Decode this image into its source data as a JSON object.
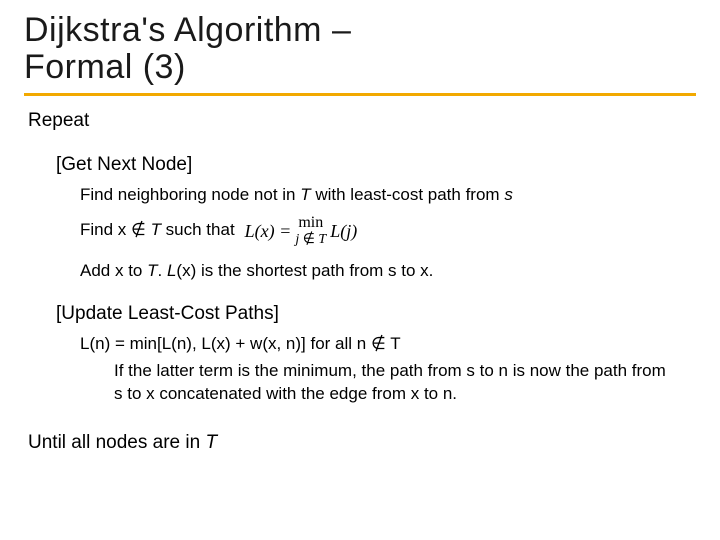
{
  "title_line1": "Dijkstra's Algorithm –",
  "title_line2": "Formal (3)",
  "repeat": "Repeat",
  "get_next_node": "[Get Next Node]",
  "find_neighbor_a": "Find neighboring node not in ",
  "find_neighbor_T": "T",
  "find_neighbor_b": " with least-cost path from ",
  "find_neighbor_s": "s",
  "find_x_a": "Find x ",
  "notin": "∉",
  "find_x_T": " T",
  "find_x_b": " such that",
  "formula_Lx": "L(x) =",
  "formula_min": "min",
  "formula_cond_a": "j ",
  "formula_cond_b": " T",
  "formula_Lj": "L(j)",
  "add_x_a": "Add x to ",
  "add_x_T": "T",
  "add_x_b": ".  ",
  "add_x_Lx": "L",
  "add_x_c": "(x) is the shortest path from s to x.",
  "update_header": "[Update Least-Cost Paths]",
  "ln_eq": "L(n) = min[L(n), L(x) + w(x, n)]   for all n ",
  "ln_T": " T",
  "explain": "If the latter term is the minimum, the path from s to n is now the path from s to x concatenated with the edge from x to n.",
  "until_a": "Until all nodes are in ",
  "until_T": "T"
}
